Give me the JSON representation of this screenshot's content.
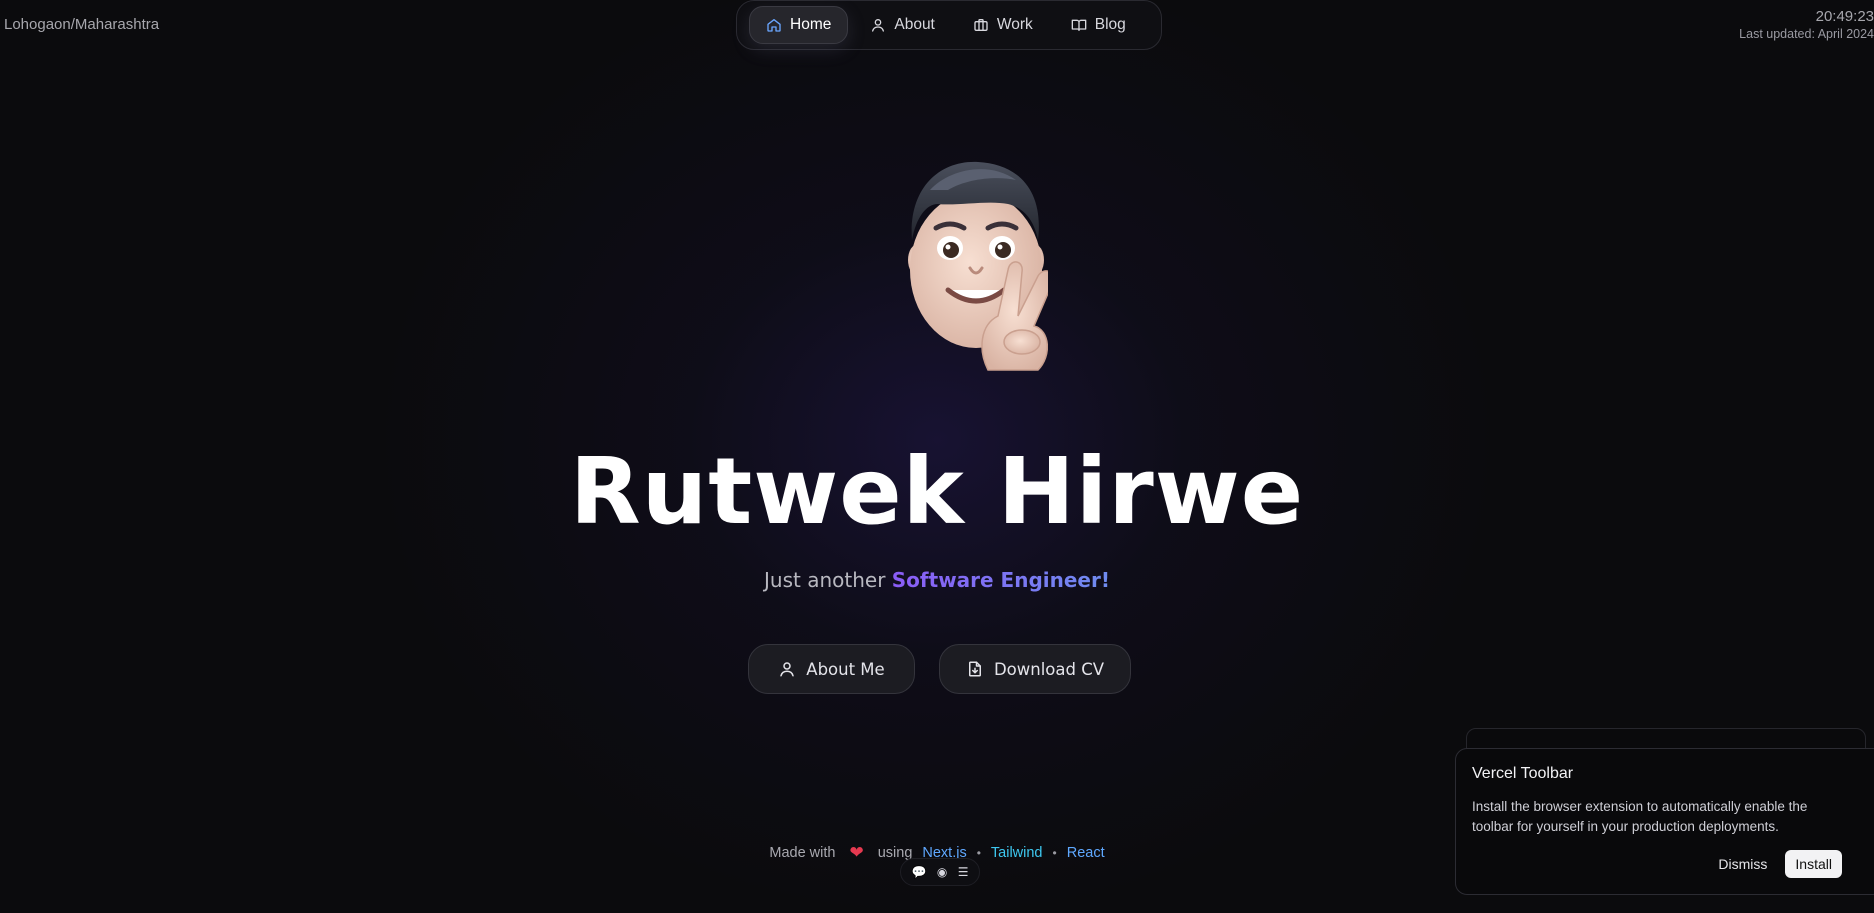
{
  "header": {
    "location": "Lohogaon/Maharashtra",
    "time": "20:49:23",
    "last_updated": "Last updated: April 2024"
  },
  "nav": {
    "items": [
      {
        "label": "Home",
        "icon": "home-icon",
        "active": true
      },
      {
        "label": "About",
        "icon": "user-icon",
        "active": false
      },
      {
        "label": "Work",
        "icon": "briefcase-icon",
        "active": false
      },
      {
        "label": "Blog",
        "icon": "book-icon",
        "active": false
      }
    ]
  },
  "hero": {
    "name": "Rutwek Hirwe",
    "subtitle_prefix": "Just another ",
    "subtitle_accent": "Software Engineer!",
    "avatar": "memoji-peace-sign",
    "accent_colors": [
      "#8b5cf6",
      "#6f8cf0"
    ]
  },
  "buttons": {
    "about": "About Me",
    "cv": "Download CV"
  },
  "footer": {
    "made_with": "Made with",
    "using": "using",
    "links": [
      "Next.js",
      "Tailwind",
      "React"
    ]
  },
  "toast": {
    "title": "Vercel Toolbar",
    "body": "Install the browser extension to automatically enable the toolbar for yourself in your production deployments.",
    "dismiss": "Dismiss",
    "install": "Install"
  }
}
